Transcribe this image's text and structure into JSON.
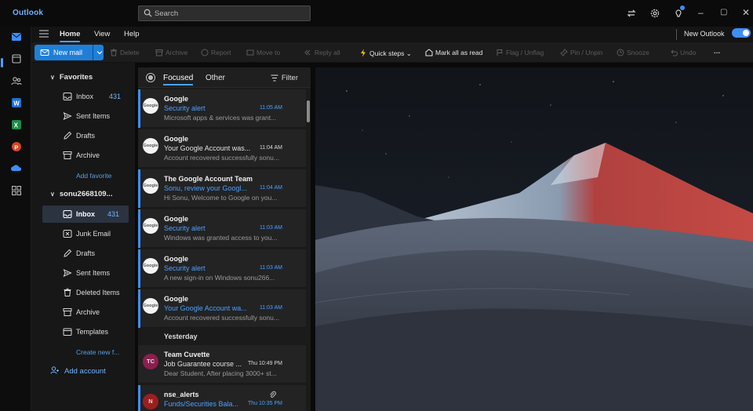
{
  "app": {
    "name": "Outlook"
  },
  "search": {
    "placeholder": "Search"
  },
  "ribbon_tabs": [
    "Home",
    "View",
    "Help"
  ],
  "new_outlook": {
    "label": "New Outlook",
    "enabled": true
  },
  "commands": {
    "new_mail": "New mail",
    "delete": "Delete",
    "archive": "Archive",
    "report": "Report",
    "move_to": "Move to",
    "reply_all": "Reply all",
    "quick_steps": "Quick steps",
    "mark_all_read": "Mark all as read",
    "flag": "Flag / Unflag",
    "pin": "Pin / Unpin",
    "snooze": "Snooze",
    "undo": "Undo",
    "more": "···"
  },
  "folders": {
    "favorites_label": "Favorites",
    "favorites": [
      {
        "name": "Inbox",
        "icon": "inbox-icon",
        "count": "431"
      },
      {
        "name": "Sent Items",
        "icon": "send-icon",
        "count": ""
      },
      {
        "name": "Drafts",
        "icon": "pencil-icon",
        "count": ""
      },
      {
        "name": "Archive",
        "icon": "archive-icon",
        "count": ""
      }
    ],
    "add_favorite": "Add favorite",
    "account_label": "sonu2668109...",
    "account_folders": [
      {
        "name": "Inbox",
        "icon": "inbox-icon",
        "count": "431"
      },
      {
        "name": "Junk Email",
        "icon": "junk-icon",
        "count": ""
      },
      {
        "name": "Drafts",
        "icon": "pencil-icon",
        "count": ""
      },
      {
        "name": "Sent Items",
        "icon": "send-icon",
        "count": ""
      },
      {
        "name": "Deleted Items",
        "icon": "trash-icon",
        "count": ""
      },
      {
        "name": "Archive",
        "icon": "archive-icon",
        "count": ""
      },
      {
        "name": "Templates",
        "icon": "template-icon",
        "count": ""
      }
    ],
    "create_new": "Create new f...",
    "add_account": "Add account"
  },
  "message_list": {
    "tabs": [
      "Focused",
      "Other"
    ],
    "filter_label": "Filter",
    "group_yesterday": "Yesterday",
    "messages": [
      {
        "from": "Google",
        "subject": "Security alert",
        "time": "11:05 AM",
        "preview": "Microsoft apps & services was grant...",
        "unread": true,
        "avatar": "Google"
      },
      {
        "from": "Google",
        "subject": "Your Google Account was...",
        "time": "11:04 AM",
        "preview": "Account recovered successfully sonu...",
        "unread": false,
        "avatar": "Google"
      },
      {
        "from": "The Google Account Team",
        "subject": "Sonu, review your Googl...",
        "time": "11:04 AM",
        "preview": "Hi Sonu, Welcome to Google on you...",
        "unread": true,
        "avatar": "Google"
      },
      {
        "from": "Google",
        "subject": "Security alert",
        "time": "11:03 AM",
        "preview": "Windows was granted access to you...",
        "unread": true,
        "avatar": "Google"
      },
      {
        "from": "Google",
        "subject": "Security alert",
        "time": "11:03 AM",
        "preview": "A new sign-in on Windows sonu266...",
        "unread": true,
        "avatar": "Google"
      },
      {
        "from": "Google",
        "subject": "Your Google Account wa...",
        "time": "11:03 AM",
        "preview": "Account recovered successfully sonu...",
        "unread": true,
        "avatar": "Google"
      }
    ],
    "older": [
      {
        "from": "Team Cuvette",
        "subject": "Job Guarantee course ...",
        "time": "Thu 10:49 PM",
        "preview": "Dear Student, After placing 3000+ st...",
        "unread": false,
        "avatar": "TC",
        "avatar_color": "#8a1f4f"
      },
      {
        "from": "nse_alerts",
        "subject": "Funds/Securities Bala...",
        "time": "Thu 10:35 PM",
        "preview": "",
        "unread": true,
        "avatar": "N",
        "avatar_color": "#9b1f1f",
        "attachment": true
      }
    ]
  },
  "colors": {
    "accent": "#3e8ef7",
    "link": "#4aa0ff"
  }
}
